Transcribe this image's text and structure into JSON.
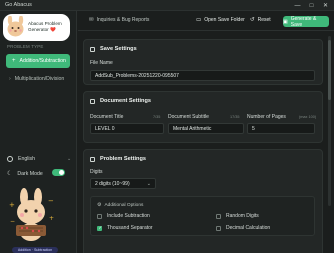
{
  "window": {
    "title": "Go Abacus",
    "controls": [
      "—",
      "□",
      "✕"
    ]
  },
  "sidebar": {
    "logo_text": [
      "Abacus Problem",
      "Generator ❤️"
    ],
    "section_label": "PROBLEM TYPE",
    "items": [
      {
        "label": "Addition/Subtraction",
        "active": true,
        "icon": "plus-icon"
      },
      {
        "label": "Multiplication/Division",
        "active": false,
        "icon": "chevron-right-icon"
      }
    ],
    "language": {
      "value": "English",
      "icon": "globe-icon"
    },
    "dark_mode": {
      "label": "Dark Mode",
      "enabled": true,
      "icon": "moon-icon"
    },
    "mascot_badge": "Addition · Subtraction"
  },
  "topbar": {
    "inquiries_label": "Inquiries & Bug Reports",
    "open_folder_label": "Open Save Folder",
    "reset_label": "Reset",
    "generate_label": "Generate & Save"
  },
  "save_settings": {
    "title": "Save Settings",
    "file_name_label": "File Name",
    "file_name_value": "AddSub_Problems-20251220-095507"
  },
  "document_settings": {
    "title": "Document Settings",
    "doc_title_label": "Document Title",
    "doc_title_counter": "7/35",
    "doc_title_value": "LEVEL 0",
    "doc_subtitle_label": "Document Subtitle",
    "doc_subtitle_counter": "17/35",
    "doc_subtitle_value": "Mental Arithmetic",
    "pages_label": "Number of Pages",
    "pages_counter": "(max 100)",
    "pages_value": "5"
  },
  "problem_settings": {
    "title": "Problem Settings",
    "digits_label": "Digits",
    "digits_value": "2 digits (10~99)",
    "additional_options_label": "Additional Options",
    "options": [
      {
        "label": "Include Subtraction",
        "checked": false
      },
      {
        "label": "Random Digits",
        "checked": false
      },
      {
        "label": "Thousand Separator",
        "checked": true
      },
      {
        "label": "Decimal Calculation",
        "checked": false
      }
    ]
  },
  "colors": {
    "accent": "#3fb97a",
    "background": "#1b1e1d",
    "card": "#232726"
  }
}
